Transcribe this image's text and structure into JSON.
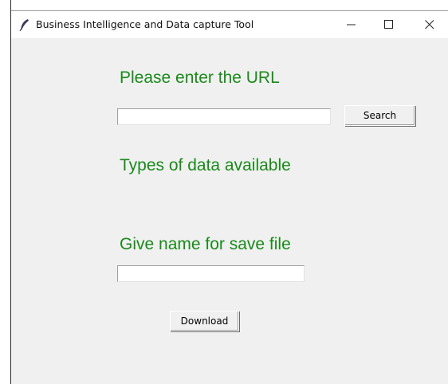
{
  "window": {
    "title": "Business Intelligence and Data capture Tool",
    "icon": "feather-icon",
    "controls": [
      "minimize-icon",
      "maximize-icon",
      "close-icon"
    ]
  },
  "form": {
    "url_prompt": "Please enter the URL",
    "url_value": "",
    "search_label": "Search",
    "types_label": "Types of data available",
    "save_prompt": "Give name for save file",
    "save_value": "",
    "download_label": "Download"
  },
  "colors": {
    "label_green": "#1a8a1a",
    "window_bg": "#f0f0f0"
  }
}
